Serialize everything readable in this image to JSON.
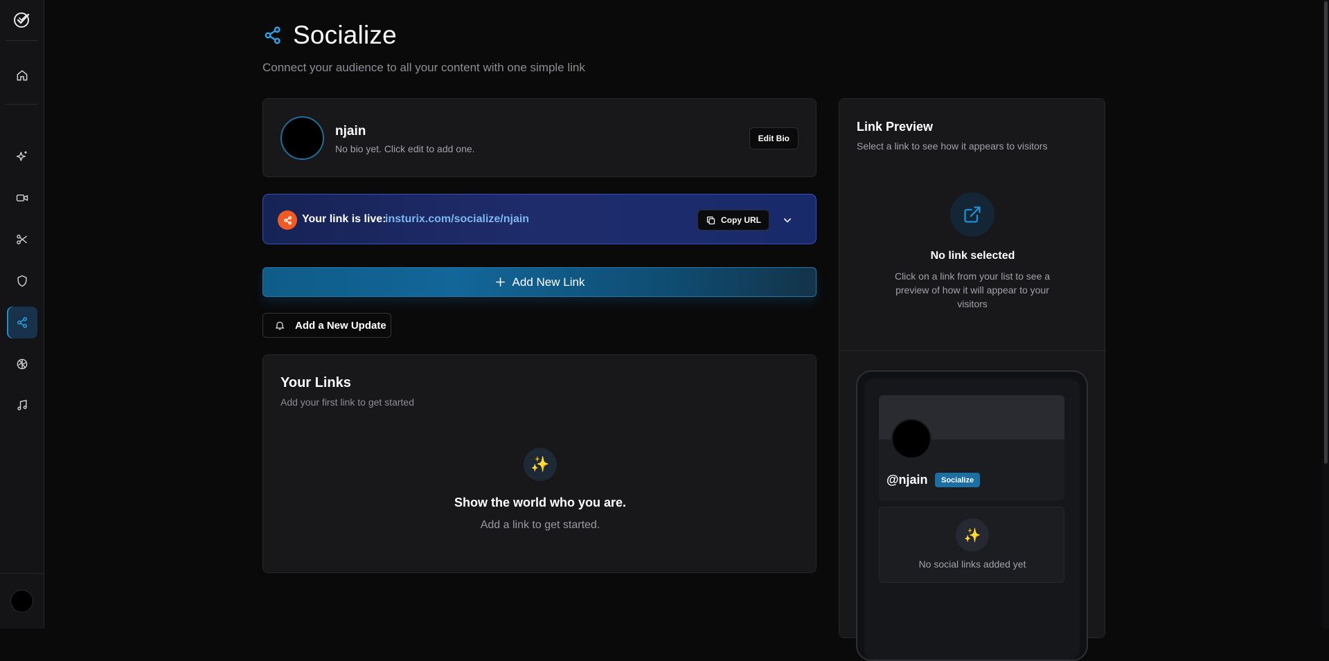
{
  "header": {
    "title": "Socialize",
    "subtitle": "Connect your audience to all your content with one simple link"
  },
  "sidebar": {
    "items": [
      {
        "icon": "home-icon"
      },
      {
        "icon": "sparkles-icon"
      },
      {
        "icon": "video-icon"
      },
      {
        "icon": "scissors-icon"
      },
      {
        "icon": "shield-icon"
      },
      {
        "icon": "share-icon",
        "active": true
      },
      {
        "icon": "brain-icon"
      },
      {
        "icon": "music-icon"
      }
    ]
  },
  "profile": {
    "name": "njain",
    "bio": "No bio yet. Click edit to add one.",
    "edit_label": "Edit Bio"
  },
  "live_link": {
    "label": "Your link is live:",
    "url": "insturix.com/socialize/njain",
    "copy_label": "Copy URL"
  },
  "actions": {
    "add_link": "Add New Link",
    "add_update": "Add a New Update"
  },
  "links": {
    "title": "Your Links",
    "subtitle": "Add your first link to get started",
    "empty_title": "Show the world who you are.",
    "empty_sub": "Add a link to get started.",
    "emoji": "✨"
  },
  "preview": {
    "title": "Link Preview",
    "subtitle": "Select a link to see how it appears to visitors",
    "empty_title": "No link selected",
    "empty_sub": "Click on a link from your list to see a preview of how it will appear to your visitors",
    "phone": {
      "handle": "@njain",
      "badge": "Socialize",
      "social_empty": "No social links added yet",
      "emoji": "✨"
    }
  },
  "colors": {
    "accent": "#1e90d6",
    "live_bg": "#1f2c6c",
    "live_icon": "#f15a22",
    "url": "#7db7f0"
  }
}
